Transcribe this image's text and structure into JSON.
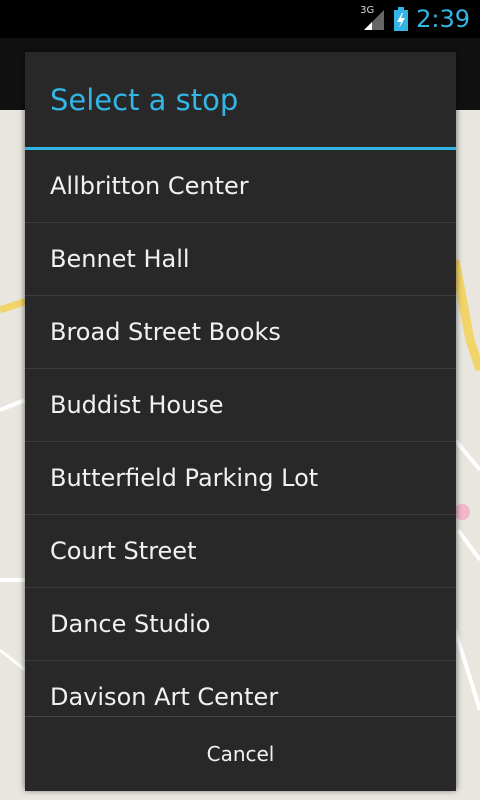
{
  "status_bar": {
    "network_type": "3G",
    "time": "2:39",
    "icons": [
      "signal-icon",
      "battery-charging-icon"
    ]
  },
  "dialog": {
    "title": "Select a stop",
    "items": [
      {
        "label": "Allbritton Center"
      },
      {
        "label": "Bennet Hall"
      },
      {
        "label": "Broad Street Books"
      },
      {
        "label": "Buddist House"
      },
      {
        "label": "Butterfield Parking Lot"
      },
      {
        "label": "Court Street"
      },
      {
        "label": "Dance Studio"
      },
      {
        "label": "Davison Art Center"
      }
    ],
    "cancel_label": "Cancel"
  },
  "colors": {
    "accent": "#33b5e5",
    "dialog_bg": "#282828",
    "map_bg": "#e9e6df"
  }
}
